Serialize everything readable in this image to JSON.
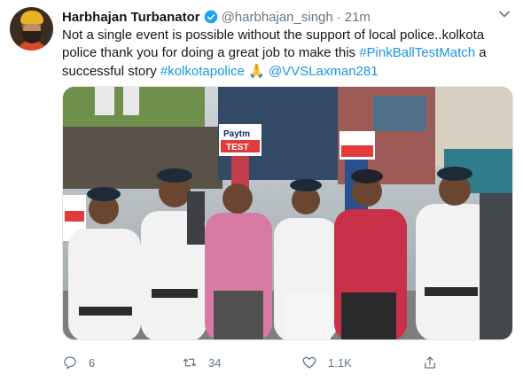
{
  "tweet": {
    "author_name": "Harbhajan Turbanator",
    "handle": "@harbhajan_singh",
    "separator": "·",
    "time": "21m",
    "text_parts": [
      {
        "t": "Not a single event is possible without the support of local police..kolkota police thank you for doing a great job to make this ",
        "link": false
      },
      {
        "t": "#PinkBallTestMatch",
        "link": true
      },
      {
        "t": " a successful story ",
        "link": false
      },
      {
        "t": "#kolkotapolice",
        "link": true
      },
      {
        "t": " 🙏 ",
        "link": false
      },
      {
        "t": "@VVSLaxman281",
        "link": true
      }
    ],
    "media_banners": [
      "Paytm",
      "TEST"
    ]
  },
  "actions": {
    "reply_count": "6",
    "retweet_count": "34",
    "like_count": "1.1K"
  },
  "colors": {
    "link": "#1b95e0",
    "secondary": "#657786",
    "verified": "#1da1f2"
  }
}
